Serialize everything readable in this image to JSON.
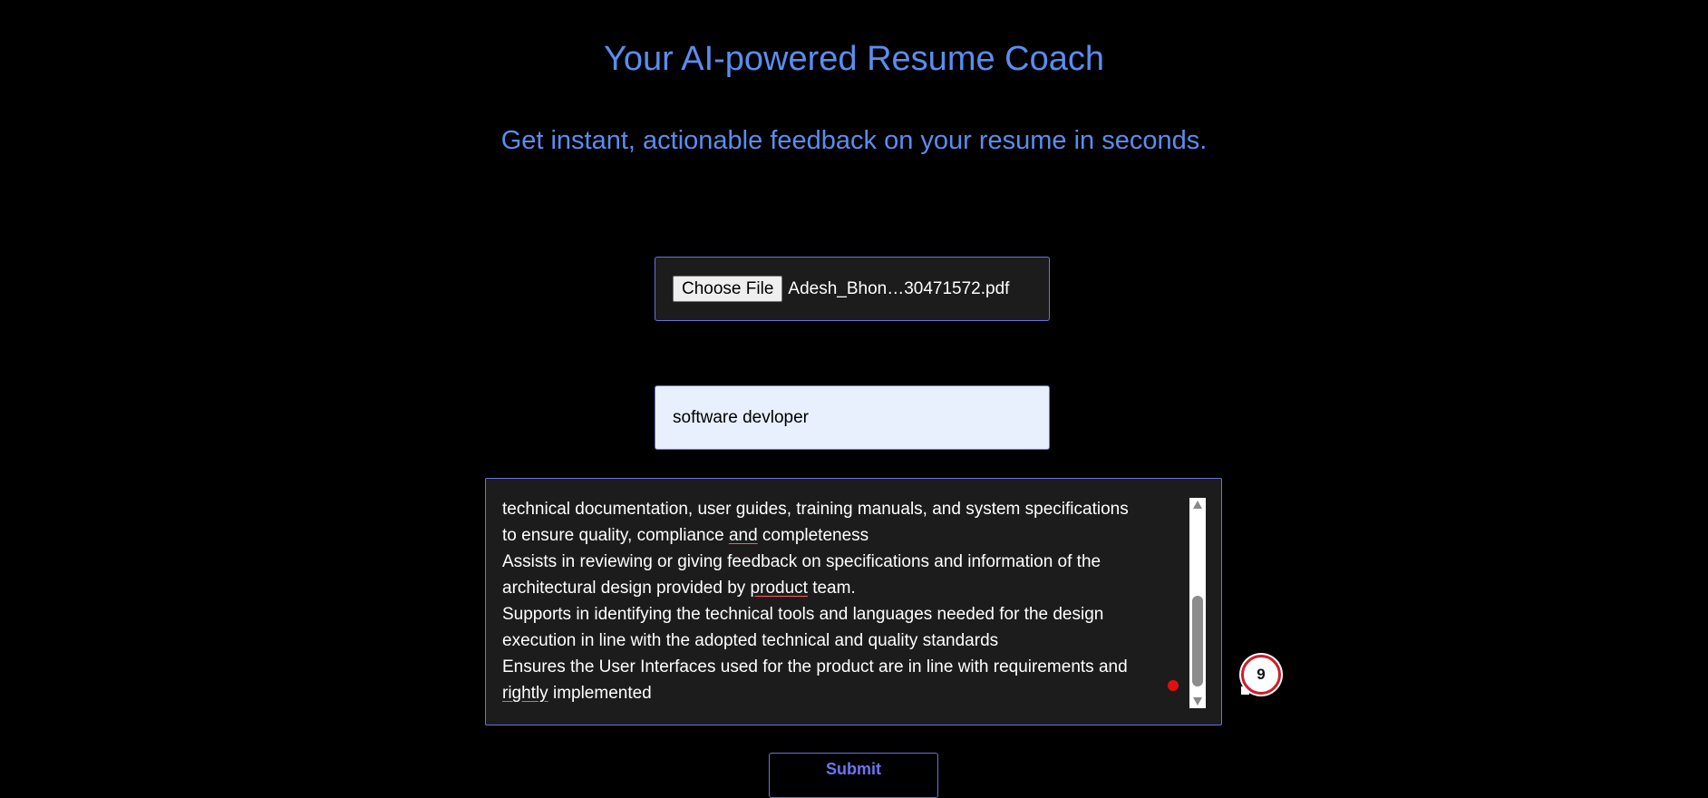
{
  "header": {
    "title": "Your AI-powered Resume Coach",
    "subtitle": "Get instant, actionable feedback on your resume in seconds."
  },
  "upload": {
    "button_label": "Choose File",
    "file_name": "Adesh_Bhon…30471572.pdf"
  },
  "role": {
    "value": "software devloper"
  },
  "job_description": {
    "lines": [
      [
        "technical documentation, user guides, training manuals, and system specifications"
      ],
      [
        "to ensure quality, compliance ",
        "and",
        " completeness"
      ],
      [
        "Assists in reviewing or giving feedback on specifications and information of the"
      ],
      [
        "architectural design provided by ",
        "product",
        " team."
      ],
      [
        "Supports in identifying the technical tools and languages needed for the design"
      ],
      [
        "execution in line with the adopted technical and quality standards"
      ],
      [
        "Ensures the User Interfaces used for the product are in line with requirements and"
      ],
      [
        "",
        "rightly",
        " implemented"
      ]
    ]
  },
  "badge": {
    "count": "9"
  },
  "submit": {
    "label": "Submit"
  },
  "colors": {
    "accent": "#5b8def",
    "border": "#6a72e0",
    "submit_text": "#6d74f5",
    "spell_error": "#ff5a5a"
  }
}
